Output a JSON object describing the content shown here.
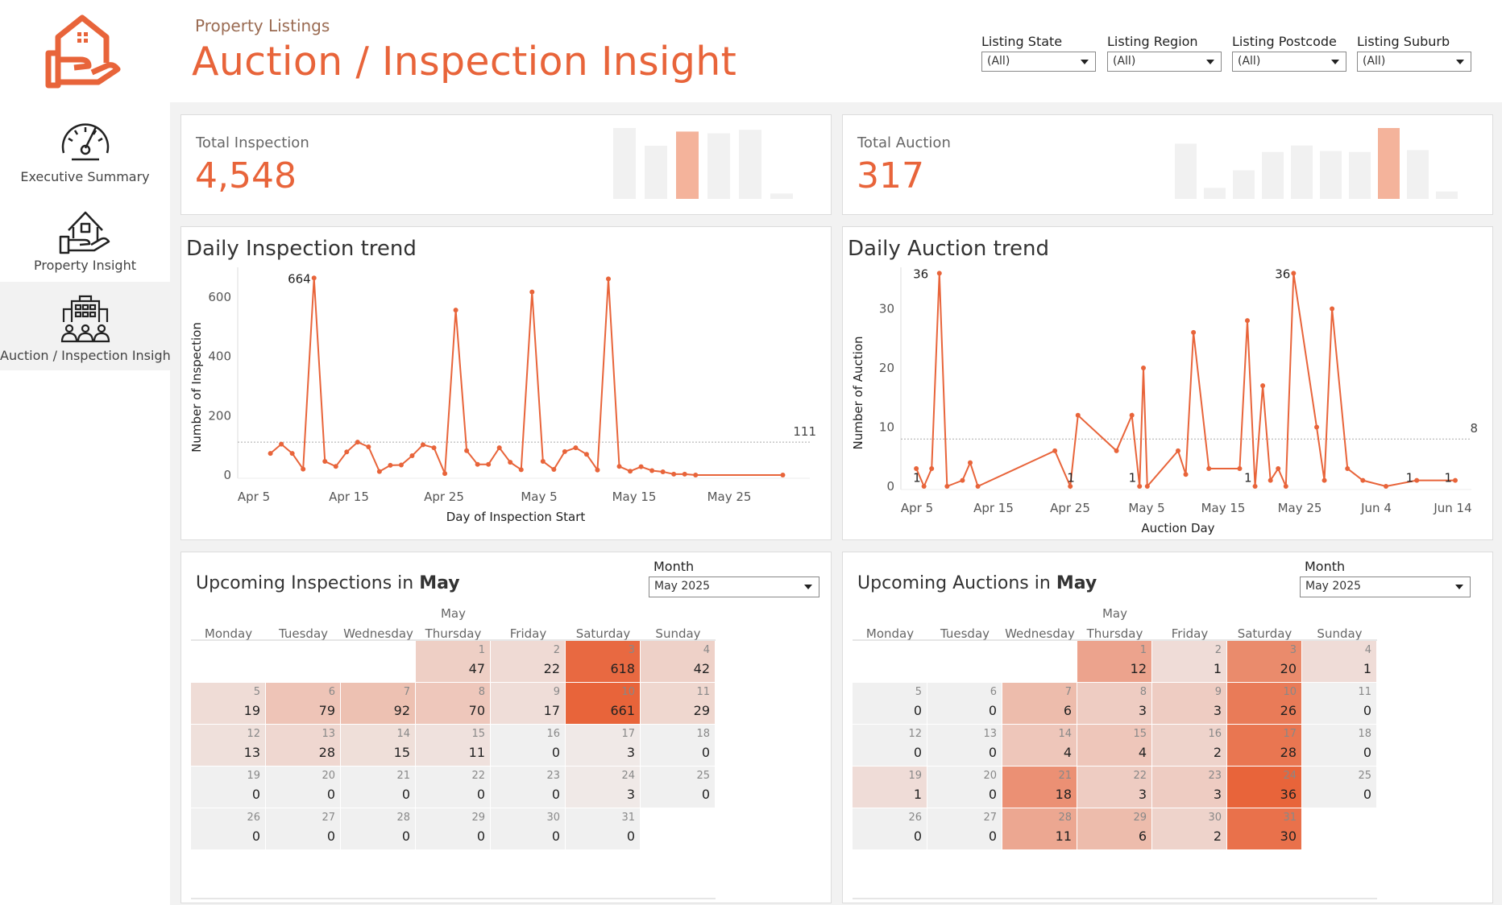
{
  "header": {
    "subtitle": "Property Listings",
    "title": "Auction / Inspection Insight"
  },
  "nav": {
    "items": [
      {
        "label": "Executive Summary",
        "icon": "speedometer-icon",
        "active": false
      },
      {
        "label": "Property Insight",
        "icon": "house-hand-icon",
        "active": false
      },
      {
        "label": "Auction / Inspection Insight",
        "icon": "buildings-people-icon",
        "active": true
      }
    ]
  },
  "filters": [
    {
      "label": "Listing State",
      "value": "(All)"
    },
    {
      "label": "Listing Region",
      "value": "(All)"
    },
    {
      "label": "Listing Postcode",
      "value": "(All)"
    },
    {
      "label": "Listing Suburb",
      "value": "(All)"
    }
  ],
  "colors": {
    "accent": "#e8643a",
    "label_brown": "#9a6b52",
    "bar_light": "#f1f1f1",
    "bar_highlight": "#f4b39b",
    "background": "#f2f2f2"
  },
  "kpis": {
    "inspection": {
      "label": "Total Inspection",
      "value": "4,548",
      "spark_values": [
        80,
        60,
        76,
        74,
        78,
        6
      ],
      "highlight_index": 2
    },
    "auction": {
      "label": "Total Auction",
      "value": "317",
      "spark_values": [
        60,
        12,
        31,
        51,
        58,
        52,
        51,
        77,
        53,
        8,
        1
      ],
      "highlight_index": 7
    }
  },
  "chart_data": [
    {
      "type": "line",
      "title": "Daily Inspection trend",
      "xlabel": "Day of Inspection Start",
      "ylabel": "Number of Inspection",
      "x_ticks": [
        "Apr 5",
        "Apr 15",
        "Apr 25",
        "May 5",
        "May 15",
        "May 25"
      ],
      "x_range": [
        0,
        51
      ],
      "ylim": [
        0,
        700
      ],
      "y_ticks": [
        0,
        200,
        400,
        600
      ],
      "reference_line": {
        "value": 111,
        "label": "111"
      },
      "point_labels": [
        {
          "x": 7,
          "y": 664,
          "text": "664"
        }
      ],
      "x": [
        3,
        4,
        5,
        6,
        7,
        8,
        9,
        10,
        11,
        12,
        13,
        14,
        15,
        16,
        17,
        18,
        19,
        20,
        21,
        22,
        23,
        24,
        25,
        26,
        27,
        28,
        29,
        30,
        31,
        32,
        33,
        34,
        35,
        36,
        37,
        38,
        39,
        40,
        41,
        42,
        50
      ],
      "y": [
        73,
        104,
        73,
        20,
        664,
        46,
        29,
        78,
        111,
        95,
        12,
        33,
        34,
        65,
        102,
        92,
        5,
        556,
        82,
        36,
        36,
        92,
        43,
        18,
        617,
        46,
        19,
        79,
        92,
        70,
        17,
        661,
        29,
        13,
        28,
        15,
        11,
        3,
        3,
        0,
        0
      ]
    },
    {
      "type": "line",
      "title": "Daily Auction trend",
      "xlabel": "Auction Day",
      "ylabel": "Number of Auction",
      "x_ticks": [
        "Apr 5",
        "Apr 15",
        "Apr 25",
        "May 5",
        "May 15",
        "May 25",
        "Jun 4",
        "Jun 14"
      ],
      "x_range": [
        0,
        72
      ],
      "ylim": [
        0,
        37
      ],
      "y_ticks": [
        0,
        10,
        20,
        30
      ],
      "reference_line": {
        "value": 8,
        "label": "8"
      },
      "point_labels": [
        {
          "x": 4,
          "y": 36,
          "text": "36"
        },
        {
          "x": 3,
          "y": 1,
          "text": "1"
        },
        {
          "x": 23,
          "y": 1,
          "text": "1"
        },
        {
          "x": 31,
          "y": 1,
          "text": "1"
        },
        {
          "x": 46,
          "y": 1,
          "text": "1"
        },
        {
          "x": 51,
          "y": 36,
          "text": "36"
        },
        {
          "x": 67,
          "y": 1,
          "text": "1"
        },
        {
          "x": 72,
          "y": 1,
          "text": "1"
        }
      ],
      "x": [
        2,
        3,
        4,
        5,
        6,
        8,
        9,
        10,
        20,
        22,
        23,
        28,
        30,
        31,
        31.5,
        32,
        36,
        37,
        38,
        40,
        44,
        45,
        46,
        47,
        48,
        49,
        50,
        51,
        54,
        55,
        56,
        58,
        60,
        63,
        67,
        72
      ],
      "y": [
        3,
        0,
        3,
        36,
        0,
        1,
        4,
        0,
        6,
        0,
        12,
        6,
        12,
        0,
        20,
        0,
        6,
        2,
        26,
        3,
        3,
        28,
        0,
        17,
        1,
        3,
        0,
        36,
        10,
        1,
        30,
        3,
        1,
        0,
        1,
        1
      ]
    }
  ],
  "calendars": {
    "inspection": {
      "title_prefix": "Upcoming Inspections in ",
      "title_month": "May",
      "month_label": "Month",
      "month_value": "May 2025",
      "header_month": "May",
      "weekdays": [
        "Monday",
        "Tuesday",
        "Wednesday",
        "Thursday",
        "Friday",
        "Saturday",
        "Sunday"
      ],
      "start_offset": 3,
      "max": 661,
      "days": [
        {
          "day": "1",
          "value": 47
        },
        {
          "day": "2",
          "value": 22
        },
        {
          "day": "3",
          "value": 618
        },
        {
          "day": "4",
          "value": 42
        },
        {
          "day": "5",
          "value": 19
        },
        {
          "day": "6",
          "value": 79
        },
        {
          "day": "7",
          "value": 92
        },
        {
          "day": "8",
          "value": 70
        },
        {
          "day": "9",
          "value": 17
        },
        {
          "day": "10",
          "value": 661
        },
        {
          "day": "11",
          "value": 29
        },
        {
          "day": "12",
          "value": 13
        },
        {
          "day": "13",
          "value": 28
        },
        {
          "day": "14",
          "value": 15
        },
        {
          "day": "15",
          "value": 11
        },
        {
          "day": "16",
          "value": 0
        },
        {
          "day": "17",
          "value": 3
        },
        {
          "day": "18",
          "value": 0
        },
        {
          "day": "19",
          "value": 0
        },
        {
          "day": "20",
          "value": 0
        },
        {
          "day": "21",
          "value": 0
        },
        {
          "day": "22",
          "value": 0
        },
        {
          "day": "23",
          "value": 0
        },
        {
          "day": "24",
          "value": 3
        },
        {
          "day": "25",
          "value": 0
        },
        {
          "day": "26",
          "value": 0
        },
        {
          "day": "27",
          "value": 0
        },
        {
          "day": "28",
          "value": 0
        },
        {
          "day": "29",
          "value": 0
        },
        {
          "day": "30",
          "value": 0
        },
        {
          "day": "31",
          "value": 0
        }
      ]
    },
    "auction": {
      "title_prefix": "Upcoming Auctions in ",
      "title_month": "May",
      "month_label": "Month",
      "month_value": "May 2025",
      "header_month": "May",
      "weekdays": [
        "Monday",
        "Tuesday",
        "Wednesday",
        "Thursday",
        "Friday",
        "Saturday",
        "Sunday"
      ],
      "start_offset": 3,
      "max": 36,
      "days": [
        {
          "day": "1",
          "value": 12
        },
        {
          "day": "2",
          "value": 1
        },
        {
          "day": "3",
          "value": 20
        },
        {
          "day": "4",
          "value": 1
        },
        {
          "day": "5",
          "value": 0
        },
        {
          "day": "6",
          "value": 0
        },
        {
          "day": "7",
          "value": 6
        },
        {
          "day": "8",
          "value": 3
        },
        {
          "day": "9",
          "value": 3
        },
        {
          "day": "10",
          "value": 26
        },
        {
          "day": "11",
          "value": 0
        },
        {
          "day": "12",
          "value": 0
        },
        {
          "day": "13",
          "value": 0
        },
        {
          "day": "14",
          "value": 4
        },
        {
          "day": "15",
          "value": 4
        },
        {
          "day": "16",
          "value": 2
        },
        {
          "day": "17",
          "value": 28
        },
        {
          "day": "18",
          "value": 0
        },
        {
          "day": "19",
          "value": 1
        },
        {
          "day": "20",
          "value": 0
        },
        {
          "day": "21",
          "value": 18
        },
        {
          "day": "22",
          "value": 3
        },
        {
          "day": "23",
          "value": 3
        },
        {
          "day": "24",
          "value": 36
        },
        {
          "day": "25",
          "value": 0
        },
        {
          "day": "26",
          "value": 0
        },
        {
          "day": "27",
          "value": 0
        },
        {
          "day": "28",
          "value": 11
        },
        {
          "day": "29",
          "value": 6
        },
        {
          "day": "30",
          "value": 2
        },
        {
          "day": "31",
          "value": 30
        }
      ]
    }
  }
}
